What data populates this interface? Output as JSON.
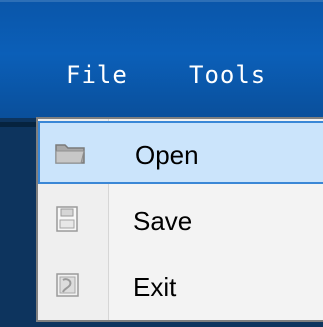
{
  "menubar": {
    "items": [
      {
        "label": "File"
      },
      {
        "label": "Tools"
      }
    ]
  },
  "dropdown": {
    "items": [
      {
        "label": "Open",
        "icon": "folder-icon",
        "selected": true
      },
      {
        "label": "Save",
        "icon": "save-icon",
        "selected": false
      },
      {
        "label": "Exit",
        "icon": "exit-icon",
        "selected": false
      }
    ]
  },
  "colors": {
    "menubar_background": "#0b5fb8",
    "selected_item_background": "#cbe4fb",
    "selected_item_border": "#3a87d6",
    "dropdown_background": "#f3f3f3",
    "dropdown_border": "#7f7f7f"
  }
}
